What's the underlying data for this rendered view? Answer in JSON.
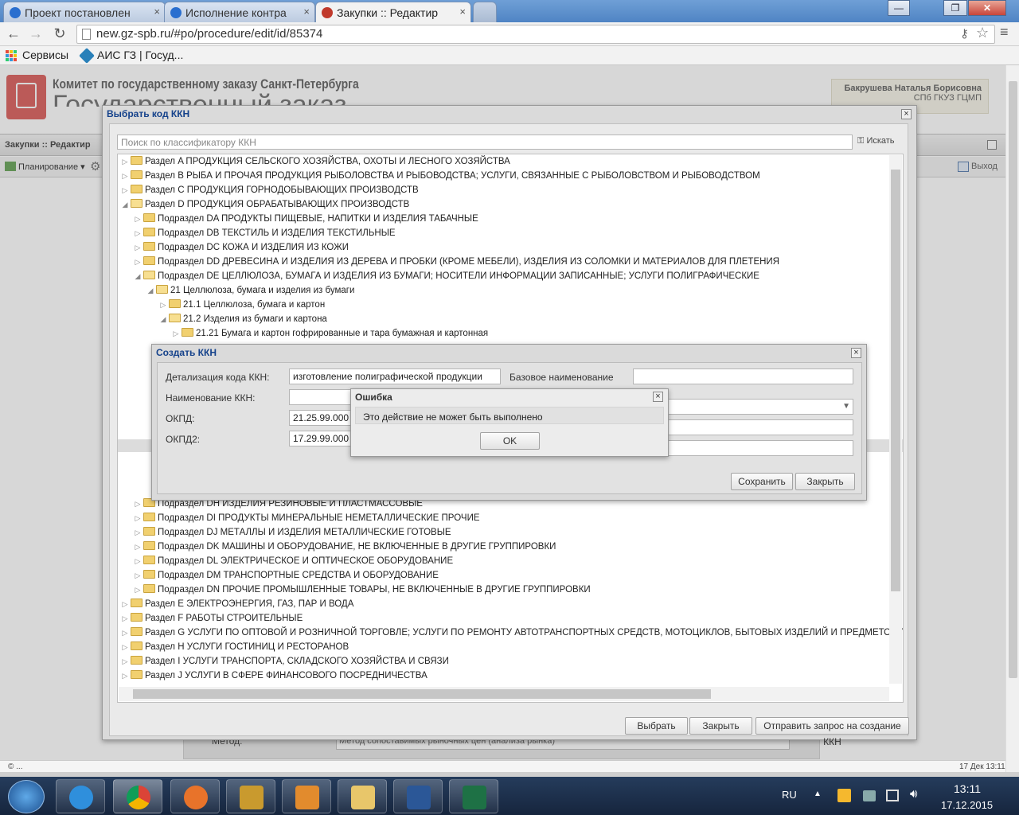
{
  "browser": {
    "tabs": [
      {
        "label": "Проект постановлен"
      },
      {
        "label": "Исполнение контра"
      },
      {
        "label": "Закупки :: Редактир"
      }
    ],
    "url": "new.gz-spb.ru/#po/procedure/edit/id/85374",
    "bookmarks": {
      "apps": "Сервисы",
      "ais": "АИС ГЗ | Госуд..."
    }
  },
  "header": {
    "committee": "Комитет по государственному заказу Санкт-Петербурга",
    "big_title": "Государственный заказ",
    "user_name": "Бакрушева Наталья Борисовна",
    "user_org": "СПб ГКУЗ ГЦМП"
  },
  "app": {
    "breadcrumb": "Закупки :: Редактир",
    "menu_planning": "Планирование",
    "exit": "Выход",
    "method_label": "Метод:",
    "method_value": "Метод сопоставимых рыночных цен (анализа рынка)"
  },
  "kkn_dialog": {
    "title": "Выбрать код ККН",
    "search_placeholder": "Поиск по классификатору ККН",
    "search_button": "Искать",
    "tree_top": [
      {
        "arrow": "▷",
        "level": 0,
        "open": false,
        "label": "Раздел A ПРОДУКЦИЯ СЕЛЬСКОГО ХОЗЯЙСТВА, ОХОТЫ И ЛЕСНОГО ХОЗЯЙСТВА"
      },
      {
        "arrow": "▷",
        "level": 0,
        "open": false,
        "label": "Раздел B РЫБА И ПРОЧАЯ ПРОДУКЦИЯ РЫБОЛОВСТВА И РЫБОВОДСТВА; УСЛУГИ, СВЯЗАННЫЕ С РЫБОЛОВСТВОМ И РЫБОВОДСТВОМ"
      },
      {
        "arrow": "▷",
        "level": 0,
        "open": false,
        "label": "Раздел C ПРОДУКЦИЯ ГОРНОДОБЫВАЮЩИХ ПРОИЗВОДСТВ"
      },
      {
        "arrow": "◢",
        "level": 0,
        "open": true,
        "label": "Раздел D ПРОДУКЦИЯ ОБРАБАТЫВАЮЩИХ ПРОИЗВОДСТВ"
      },
      {
        "arrow": "▷",
        "level": 1,
        "open": false,
        "label": "Подраздел DA ПРОДУКТЫ ПИЩЕВЫЕ, НАПИТКИ И ИЗДЕЛИЯ ТАБАЧНЫЕ"
      },
      {
        "arrow": "▷",
        "level": 1,
        "open": false,
        "label": "Подраздел DB ТЕКСТИЛЬ И ИЗДЕЛИЯ ТЕКСТИЛЬНЫЕ"
      },
      {
        "arrow": "▷",
        "level": 1,
        "open": false,
        "label": "Подраздел DC КОЖА И ИЗДЕЛИЯ ИЗ КОЖИ"
      },
      {
        "arrow": "▷",
        "level": 1,
        "open": false,
        "label": "Подраздел DD ДРЕВЕСИНА И ИЗДЕЛИЯ ИЗ ДЕРЕВА И ПРОБКИ (КРОМЕ МЕБЕЛИ), ИЗДЕЛИЯ ИЗ СОЛОМКИ И МАТЕРИАЛОВ ДЛЯ ПЛЕТЕНИЯ"
      },
      {
        "arrow": "◢",
        "level": 1,
        "open": true,
        "label": "Подраздел DE ЦЕЛЛЮЛОЗА, БУМАГА И ИЗДЕЛИЯ ИЗ БУМАГИ; НОСИТЕЛИ ИНФОРМАЦИИ ЗАПИСАННЫЕ; УСЛУГИ ПОЛИГРАФИЧЕСКИЕ"
      },
      {
        "arrow": "◢",
        "level": 2,
        "open": true,
        "label": "21 Целлюлоза, бумага и изделия из бумаги"
      },
      {
        "arrow": "▷",
        "level": 3,
        "open": false,
        "label": "21.1 Целлюлоза, бумага и картон"
      },
      {
        "arrow": "◢",
        "level": 3,
        "open": true,
        "label": "21.2 Изделия из бумаги и картона"
      },
      {
        "arrow": "▷",
        "level": 4,
        "open": false,
        "label": "21.21 Бумага и картон гофрированные и тара бумажная и картонная"
      }
    ],
    "tree_bottom": [
      {
        "arrow": "▷",
        "level": 1,
        "open": false,
        "label": "Подраздел DH ИЗДЕЛИЯ РЕЗИНОВЫЕ И ПЛАСТМАССОВЫЕ"
      },
      {
        "arrow": "▷",
        "level": 1,
        "open": false,
        "label": "Подраздел DI ПРОДУКТЫ МИНЕРАЛЬНЫЕ НЕМЕТАЛЛИЧЕСКИЕ ПРОЧИЕ"
      },
      {
        "arrow": "▷",
        "level": 1,
        "open": false,
        "label": "Подраздел DJ МЕТАЛЛЫ И ИЗДЕЛИЯ МЕТАЛЛИЧЕСКИЕ ГОТОВЫЕ"
      },
      {
        "arrow": "▷",
        "level": 1,
        "open": false,
        "label": "Подраздел DK МАШИНЫ И ОБОРУДОВАНИЕ, НЕ ВКЛЮЧЕННЫЕ В ДРУГИЕ ГРУППИРОВКИ"
      },
      {
        "arrow": "▷",
        "level": 1,
        "open": false,
        "label": "Подраздел DL ЭЛЕКТРИЧЕСКОЕ И ОПТИЧЕСКОЕ ОБОРУДОВАНИЕ"
      },
      {
        "arrow": "▷",
        "level": 1,
        "open": false,
        "label": "Подраздел DM ТРАНСПОРТНЫЕ СРЕДСТВА И ОБОРУДОВАНИЕ"
      },
      {
        "arrow": "▷",
        "level": 1,
        "open": false,
        "label": "Подраздел DN ПРОЧИЕ ПРОМЫШЛЕННЫЕ ТОВАРЫ, НЕ ВКЛЮЧЕННЫЕ В ДРУГИЕ ГРУППИРОВКИ"
      },
      {
        "arrow": "▷",
        "level": 0,
        "open": false,
        "label": "Раздел E ЭЛЕКТРОЭНЕРГИЯ, ГАЗ, ПАР И ВОДА"
      },
      {
        "arrow": "▷",
        "level": 0,
        "open": false,
        "label": "Раздел F РАБОТЫ СТРОИТЕЛЬНЫЕ"
      },
      {
        "arrow": "▷",
        "level": 0,
        "open": false,
        "label": "Раздел G УСЛУГИ ПО ОПТОВОЙ И РОЗНИЧНОЙ ТОРГОВЛЕ; УСЛУГИ ПО РЕМОНТУ АВТОТРАНСПОРТНЫХ СРЕДСТВ, МОТОЦИКЛОВ, БЫТОВЫХ ИЗДЕЛИЙ И ПРЕДМЕТОВ ЛИЧ"
      },
      {
        "arrow": "▷",
        "level": 0,
        "open": false,
        "label": "Раздел H УСЛУГИ ГОСТИНИЦ И РЕСТОРАНОВ"
      },
      {
        "arrow": "▷",
        "level": 0,
        "open": false,
        "label": "Раздел I УСЛУГИ ТРАНСПОРТА, СКЛАДСКОГО ХОЗЯЙСТВА И СВЯЗИ"
      },
      {
        "arrow": "▷",
        "level": 0,
        "open": false,
        "label": "Раздел J УСЛУГИ В СФЕРЕ ФИНАНСОВОГО ПОСРЕДНИЧЕСТВА"
      }
    ],
    "buttons": {
      "select": "Выбрать",
      "close": "Закрыть",
      "send_request": "Отправить запрос на создание ККН"
    }
  },
  "create_dialog": {
    "title": "Создать ККН",
    "detail_label": "Детализация кода ККН:",
    "detail_value": "изготовление полиграфической продукции",
    "base_name_label": "Базовое наименование товара:",
    "name_label": "Наименование ККН:",
    "okpd_label": "ОКПД:",
    "okpd_value": "21.25.99.000",
    "okpd2_label": "ОКПД2:",
    "okpd2_value": "17.29.99.000",
    "save": "Сохранить",
    "close": "Закрыть"
  },
  "error_dialog": {
    "title": "Ошибка",
    "message": "Это действие не может быть выполнено",
    "ok": "OK"
  },
  "status": {
    "left": "© ...",
    "right": "17 Дек 13:11"
  },
  "taskbar": {
    "lang": "RU",
    "time": "13:11",
    "date": "17.12.2015"
  },
  "colors": {
    "titlebar": "#4f84c4",
    "dialog_title": "#15428b",
    "taskbar": "#1d3150",
    "logo": "#d9534f"
  }
}
